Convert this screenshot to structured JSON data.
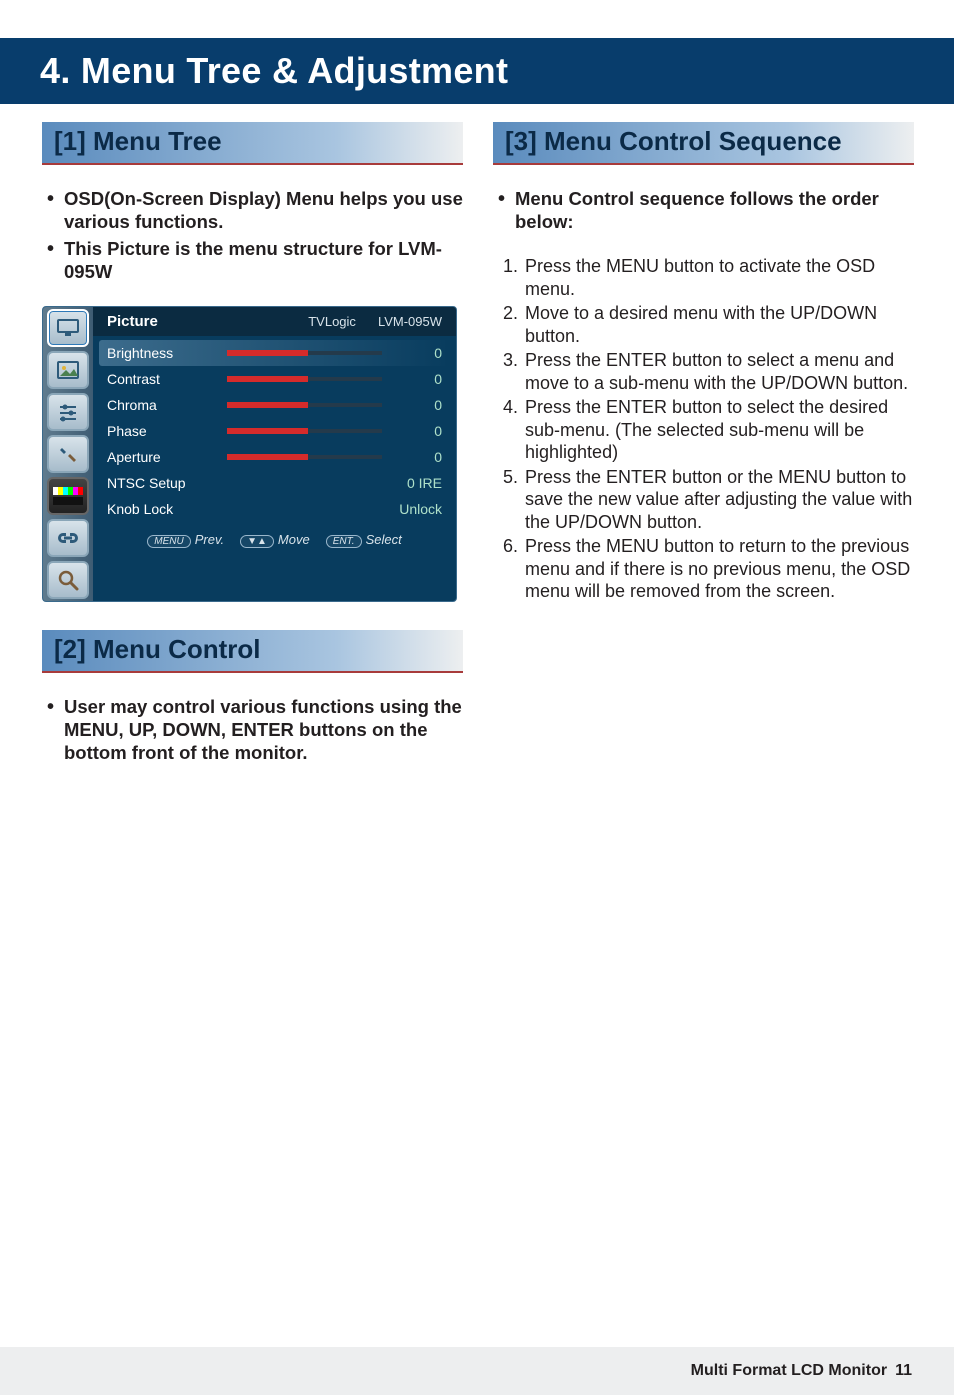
{
  "header": {
    "title": "4. Menu Tree & Adjustment"
  },
  "left": {
    "s1": {
      "heading": "[1] Menu Tree",
      "bullets": [
        "OSD(On-Screen Display) Menu helps you use various functions.",
        "This Picture is the menu structure for LVM-095W"
      ]
    },
    "osd": {
      "category": "Picture",
      "brand": "TVLogic",
      "model": "LVM-095W",
      "rows": [
        {
          "label": "Brightness",
          "value": "0",
          "slider": true
        },
        {
          "label": "Contrast",
          "value": "0",
          "slider": true
        },
        {
          "label": "Chroma",
          "value": "0",
          "slider": true
        },
        {
          "label": "Phase",
          "value": "0",
          "slider": true
        },
        {
          "label": "Aperture",
          "value": "0",
          "slider": true
        },
        {
          "label": "NTSC Setup",
          "value": "0 IRE",
          "slider": false
        },
        {
          "label": "Knob Lock",
          "value": "Unlock",
          "slider": false
        }
      ],
      "footer": {
        "menu_btn": "MENU",
        "menu_txt": "Prev.",
        "move_btn": "▼▲",
        "move_txt": "Move",
        "ent_btn": "ENT.",
        "ent_txt": "Select"
      },
      "icons": [
        "monitor",
        "picture",
        "sliders",
        "tools",
        "testpattern",
        "link",
        "search"
      ]
    },
    "s2": {
      "heading": "[2] Menu Control",
      "bullets": [
        "User may control various functions using the MENU, UP, DOWN, ENTER buttons on the bottom front of the monitor."
      ]
    }
  },
  "right": {
    "s3": {
      "heading": "[3] Menu Control Sequence",
      "bullets": [
        "Menu Control sequence follows the order below:"
      ],
      "steps": [
        "Press the MENU button to activate the OSD menu.",
        "Move to a desired menu with the UP/DOWN button.",
        "Press the ENTER button to select a menu and move to a sub-menu with the UP/DOWN button.",
        "Press the ENTER button to select the desired sub-menu. (The selected sub-menu will be highlighted)",
        "Press the ENTER button or the MENU button to save the new value after adjusting the value with the UP/DOWN button.",
        "Press the MENU button to return to the previous menu and if there is no previous menu, the OSD menu will be removed from the screen."
      ]
    }
  },
  "footer": {
    "label": "Multi Format LCD Monitor",
    "page": "11"
  }
}
